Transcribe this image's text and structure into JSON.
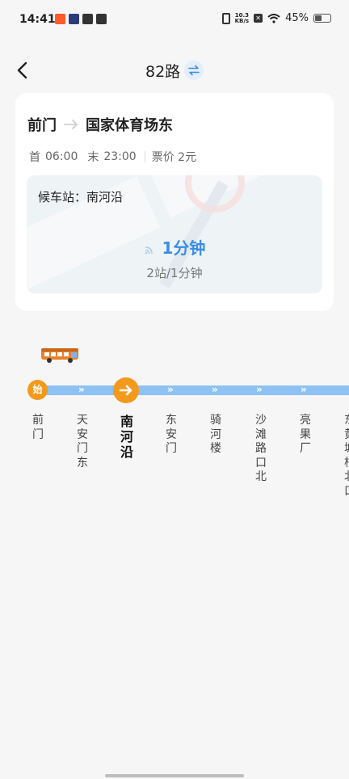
{
  "status_bar": {
    "time": "14:41",
    "net_speed_value": "10.3",
    "net_speed_unit": "KB/s",
    "battery": "45%",
    "battery_level": 0.45,
    "app_icon_colors": [
      "#ff5a2a",
      "#2a3a7a",
      "#333333",
      "#333333"
    ]
  },
  "header": {
    "title": "82路",
    "back_icon": "chevron-left-icon",
    "swap_icon": "swap-direction-icon"
  },
  "route_card": {
    "from": "前门",
    "to": "国家体育场东",
    "first_label": "首",
    "first_time": "06:00",
    "last_label": "末",
    "last_time": "23:00",
    "fare": "票价 2元",
    "wait_station_label": "候车站：南河沿",
    "eta": "1分钟",
    "eta_detail": "2站/1分钟"
  },
  "line": {
    "start_badge": "始",
    "current_stop_index": 2,
    "stops": [
      "前门",
      "天安门东",
      "南河沿",
      "东安门",
      "骑河楼",
      "沙滩路口北",
      "亮果厂",
      "东黄城根北口"
    ]
  },
  "colors": {
    "accent_blue": "#3a8ee6",
    "track_blue": "#8ec2f3",
    "stop_orange": "#f39a1c"
  }
}
